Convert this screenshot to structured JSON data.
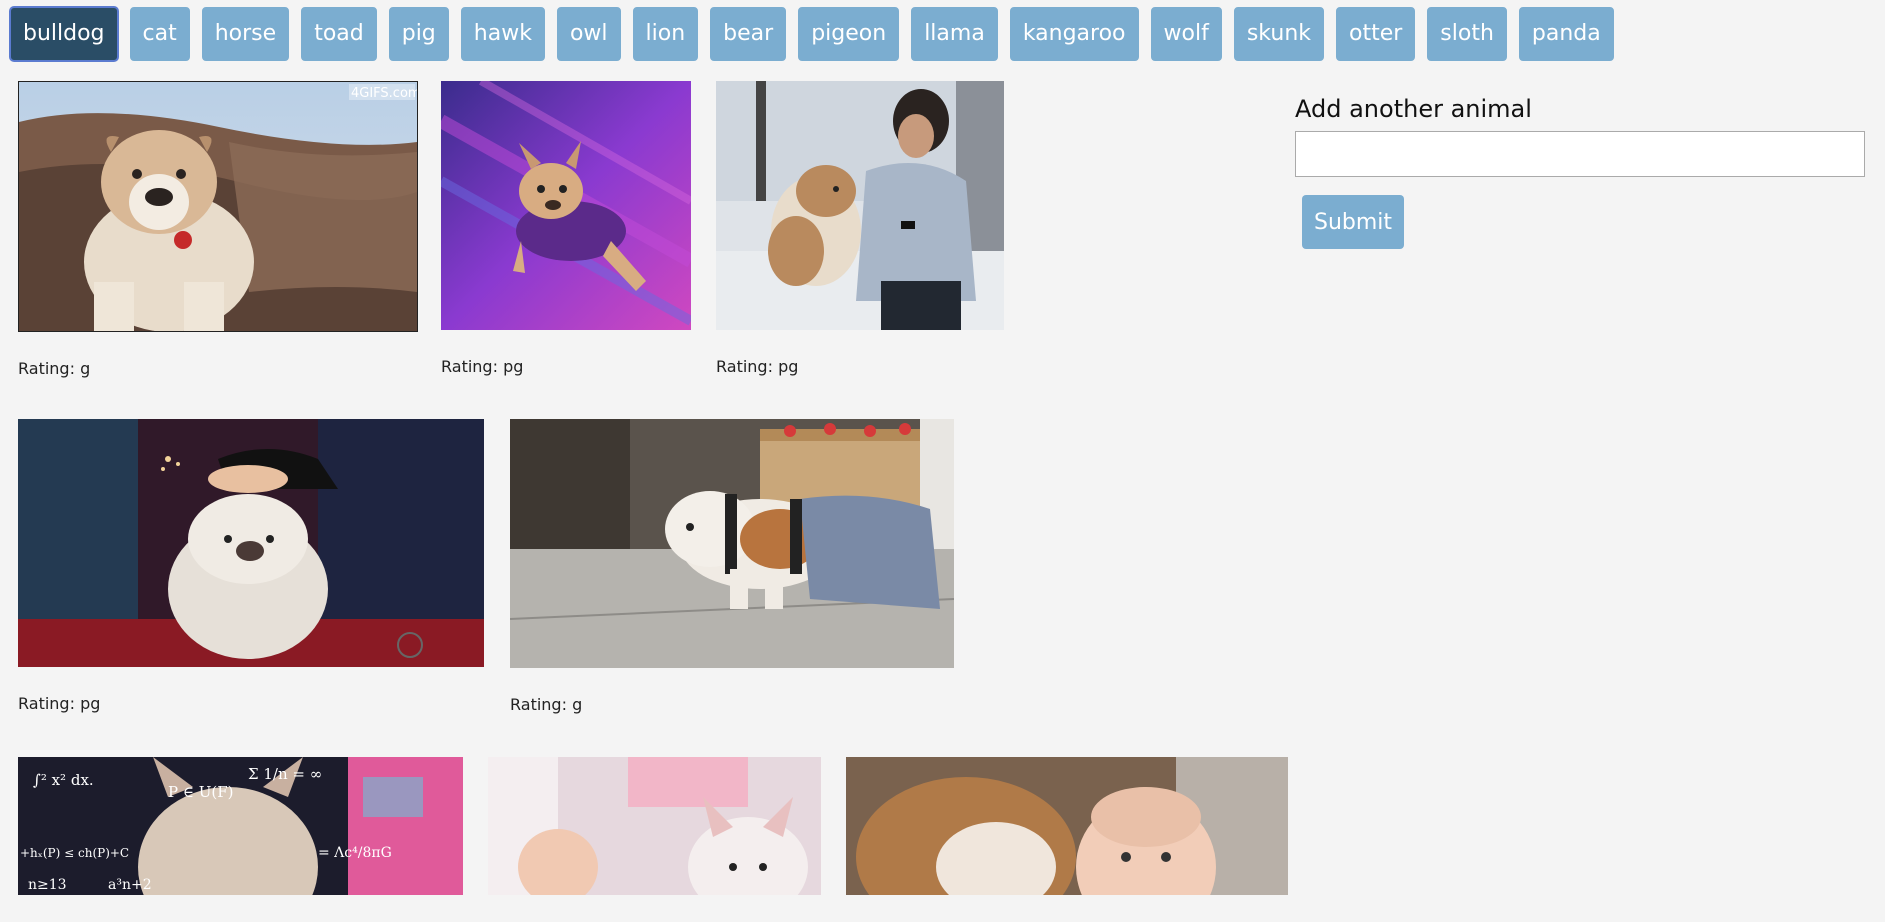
{
  "animals": [
    {
      "label": "bulldog",
      "active": true
    },
    {
      "label": "cat"
    },
    {
      "label": "horse"
    },
    {
      "label": "toad"
    },
    {
      "label": "pig"
    },
    {
      "label": "hawk"
    },
    {
      "label": "owl"
    },
    {
      "label": "lion"
    },
    {
      "label": "bear"
    },
    {
      "label": "pigeon"
    },
    {
      "label": "llama"
    },
    {
      "label": "kangaroo"
    },
    {
      "label": "wolf"
    },
    {
      "label": "skunk"
    },
    {
      "label": "otter"
    },
    {
      "label": "sloth"
    },
    {
      "label": "panda"
    }
  ],
  "gifs": [
    {
      "rating": "Rating: g",
      "watermark": "4GIFS.com"
    },
    {
      "rating": "Rating: pg"
    },
    {
      "rating": "Rating: pg"
    },
    {
      "rating": "Rating: pg"
    },
    {
      "rating": "Rating: g"
    },
    {
      "rating": ""
    },
    {
      "rating": ""
    },
    {
      "rating": ""
    }
  ],
  "form": {
    "title": "Add another animal",
    "input_value": "",
    "submit_label": "Submit"
  },
  "colors": {
    "button": "#7badd0",
    "button_active": "#2a4d66",
    "background": "#f4f4f4"
  }
}
